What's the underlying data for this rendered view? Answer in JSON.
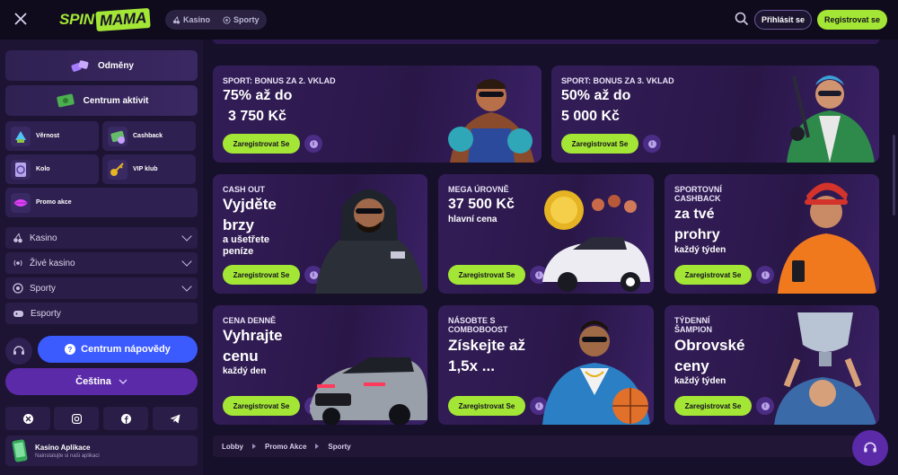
{
  "header": {
    "logo_left": "SPIN",
    "logo_right": "MAMA",
    "nav": [
      {
        "label": "Kasino",
        "icon": "cherry-icon"
      },
      {
        "label": "Sporty",
        "icon": "ball-icon"
      }
    ],
    "login_label": "Přihlásit se",
    "register_label": "Registrovat se"
  },
  "sidebar": {
    "rewards_label": "Odměny",
    "activity_label": "Centrum aktivit",
    "tiles": [
      {
        "label": "Věrnost"
      },
      {
        "label": "Cashback"
      },
      {
        "label": "Kolo"
      },
      {
        "label": "VIP klub"
      },
      {
        "label": "Promo akce"
      }
    ],
    "rows": [
      {
        "label": "Kasino"
      },
      {
        "label": "Živé kasino"
      },
      {
        "label": "Sporty"
      },
      {
        "label": "Esporty"
      }
    ],
    "help_label": "Centrum nápovědy",
    "language_label": "Čeština",
    "app_title": "Kasino Aplikace",
    "app_subtitle": "Nainstalujte si naši aplikaci"
  },
  "cards": [
    {
      "head": "SPORT: BONUS ZA 2. VKLAD",
      "big1": "75% až do",
      "big2": "3 750 Kč",
      "cta": "Zaregistrovat Se"
    },
    {
      "head": "SPORT: BONUS ZA 3. VKLAD",
      "big1": "50% až do",
      "big2": "5 000 Kč",
      "cta": "Zaregistrovat Se"
    },
    {
      "head": "CASH OUT",
      "big1": "Vyjděte",
      "big2": "brzy",
      "sub1": "a ušetřete",
      "sub2": "peníze",
      "cta": "Zaregistrovat Se"
    },
    {
      "head": "MEGA ÚROVNĚ",
      "big1": "37 500 Kč",
      "sub1": "hlavní cena",
      "cta": "Zaregistrovat Se"
    },
    {
      "head": "SPORTOVNÍ",
      "head2": "CASHBACK",
      "big1": "za tvé",
      "big2": "prohry",
      "sub1": "každý týden",
      "cta": "Zaregistrovat Se"
    },
    {
      "head": "CENA DENNĚ",
      "big1": "Vyhrajte",
      "big2": "cenu",
      "sub1": "každý den",
      "cta": "Zaregistrovat Se"
    },
    {
      "head": "NÁSOBTE S",
      "head2": "COMBOBOOST",
      "big1": "Získejte až",
      "big2": "1,5x ...",
      "cta": "Zaregistrovat Se"
    },
    {
      "head": "TÝDENNÍ",
      "head2": "ŠAMPION",
      "big1": "Obrovské",
      "big2": "ceny",
      "sub1": "každý týden",
      "cta": "Zaregistrovat Se"
    }
  ],
  "breadcrumb": [
    "Lobby",
    "Promo Akce",
    "Sporty"
  ],
  "colors": {
    "accent": "#a3e635",
    "help": "#3b5bff",
    "language": "#5b2aa8"
  }
}
